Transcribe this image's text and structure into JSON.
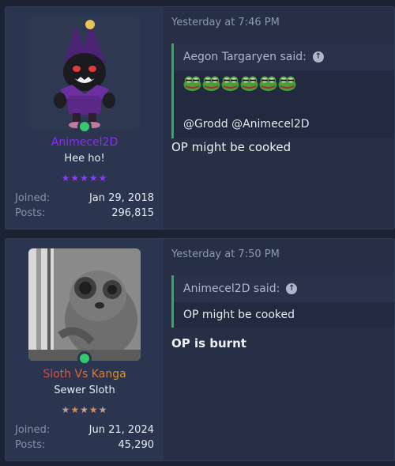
{
  "posts": [
    {
      "user": {
        "name": "Animecel2D",
        "name_color": "#8b2cf5",
        "title": "Hee ho!",
        "stars": "★★★★★",
        "joined_label": "Joined:",
        "joined": "Jan 29, 2018",
        "posts_label": "Posts:",
        "posts": "296,815",
        "avatar_icon": "purple-jester-figure"
      },
      "timestamp": "Yesterday at 7:46 PM",
      "quote": {
        "author": "Aegon Targaryen said:",
        "emoji_count": 6,
        "emoji_icon": "pepe-frog-emoji",
        "mentions": "@Grodd @Animecel2D"
      },
      "message": "OP might be cooked"
    },
    {
      "user": {
        "name": "Sloth Vs Kanga",
        "name_color": "#e0623a",
        "title": "Sewer Sloth",
        "stars": "★★★★★",
        "joined_label": "Joined:",
        "joined": "Jun 21, 2024",
        "posts_label": "Posts:",
        "posts": "45,290",
        "avatar_icon": "grayscale-slow-loris-photo"
      },
      "timestamp": "Yesterday at 7:50 PM",
      "quote": {
        "author": "Animecel2D said:",
        "text": "OP might be cooked"
      },
      "message": "OP is burnt"
    }
  ]
}
